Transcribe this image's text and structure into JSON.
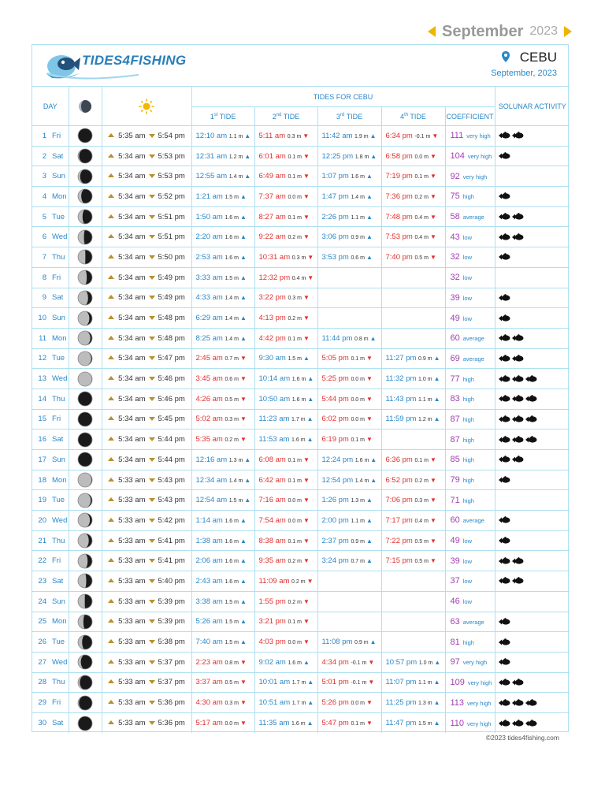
{
  "nav": {
    "month": "September",
    "year": "2023"
  },
  "header": {
    "logo_text": "TIDES4FISHING",
    "location": "CEBU",
    "date": "September, 2023"
  },
  "columns": {
    "day": "DAY",
    "tides_group": "TIDES FOR CEBU",
    "tide1": "TIDE",
    "tide1_ord": "st",
    "tide1_n": "1",
    "tide2": "TIDE",
    "tide2_ord": "nd",
    "tide2_n": "2",
    "tide3": "TIDE",
    "tide3_ord": "rd",
    "tide3_n": "3",
    "tide4": "TIDE",
    "tide4_ord": "th",
    "tide4_n": "4",
    "coefficient": "COEFFICIENT",
    "solunar": "SOLUNAR ACTIVITY"
  },
  "colors": {
    "high_tide": "#2a88c8",
    "low_tide": "#e03030",
    "coefficient": "#a040b0",
    "border": "#aee0f2"
  },
  "days": [
    {
      "n": "1",
      "wd": "Fri",
      "moon": 0.97,
      "rise": "5:35 am",
      "set": "5:54 pm",
      "tides": [
        [
          "12:10 am",
          "1.1 m",
          "H"
        ],
        [
          "5:11 am",
          "0.3 m",
          "L"
        ],
        [
          "11:42 am",
          "1.9 m",
          "H"
        ],
        [
          "6:34 pm",
          "-0.1 m",
          "L"
        ]
      ],
      "coef": "111",
      "lvl": "very high",
      "sol": 2
    },
    {
      "n": "2",
      "wd": "Sat",
      "moon": 0.92,
      "rise": "5:34 am",
      "set": "5:53 pm",
      "tides": [
        [
          "12:31 am",
          "1.2 m",
          "H"
        ],
        [
          "6:01 am",
          "0.1 m",
          "L"
        ],
        [
          "12:25 pm",
          "1.8 m",
          "H"
        ],
        [
          "6:58 pm",
          "0.0 m",
          "L"
        ]
      ],
      "coef": "104",
      "lvl": "very high",
      "sol": 1
    },
    {
      "n": "3",
      "wd": "Sun",
      "moon": 0.85,
      "rise": "5:34 am",
      "set": "5:53 pm",
      "tides": [
        [
          "12:55 am",
          "1.4 m",
          "H"
        ],
        [
          "6:49 am",
          "0.1 m",
          "L"
        ],
        [
          "1:07 pm",
          "1.6 m",
          "H"
        ],
        [
          "7:19 pm",
          "0.1 m",
          "L"
        ]
      ],
      "coef": "92",
      "lvl": "very high",
      "sol": 0
    },
    {
      "n": "4",
      "wd": "Mon",
      "moon": 0.77,
      "rise": "5:34 am",
      "set": "5:52 pm",
      "tides": [
        [
          "1:21 am",
          "1.5 m",
          "H"
        ],
        [
          "7:37 am",
          "0.0 m",
          "L"
        ],
        [
          "1:47 pm",
          "1.4 m",
          "H"
        ],
        [
          "7:36 pm",
          "0.2 m",
          "L"
        ]
      ],
      "coef": "75",
      "lvl": "high",
      "sol": 1
    },
    {
      "n": "5",
      "wd": "Tue",
      "moon": 0.68,
      "rise": "5:34 am",
      "set": "5:51 pm",
      "tides": [
        [
          "1:50 am",
          "1.6 m",
          "H"
        ],
        [
          "8:27 am",
          "0.1 m",
          "L"
        ],
        [
          "2:26 pm",
          "1.1 m",
          "H"
        ],
        [
          "7:48 pm",
          "0.4 m",
          "L"
        ]
      ],
      "coef": "58",
      "lvl": "average",
      "sol": 2
    },
    {
      "n": "6",
      "wd": "Wed",
      "moon": 0.58,
      "rise": "5:34 am",
      "set": "5:51 pm",
      "tides": [
        [
          "2:20 am",
          "1.6 m",
          "H"
        ],
        [
          "9:22 am",
          "0.2 m",
          "L"
        ],
        [
          "3:06 pm",
          "0.9 m",
          "H"
        ],
        [
          "7:53 pm",
          "0.4 m",
          "L"
        ]
      ],
      "coef": "43",
      "lvl": "low",
      "sol": 2
    },
    {
      "n": "7",
      "wd": "Thu",
      "moon": 0.48,
      "rise": "5:34 am",
      "set": "5:50 pm",
      "tides": [
        [
          "2:53 am",
          "1.6 m",
          "H"
        ],
        [
          "10:31 am",
          "0.3 m",
          "L"
        ],
        [
          "3:53 pm",
          "0.6 m",
          "H"
        ],
        [
          "7:40 pm",
          "0.5 m",
          "L"
        ]
      ],
      "coef": "32",
      "lvl": "low",
      "sol": 1
    },
    {
      "n": "8",
      "wd": "Fri",
      "moon": 0.38,
      "rise": "5:34 am",
      "set": "5:49 pm",
      "tides": [
        [
          "3:33 am",
          "1.5 m",
          "H"
        ],
        [
          "12:32 pm",
          "0.4 m",
          "L"
        ]
      ],
      "coef": "32",
      "lvl": "low",
      "sol": 0
    },
    {
      "n": "9",
      "wd": "Sat",
      "moon": 0.29,
      "rise": "5:34 am",
      "set": "5:49 pm",
      "tides": [
        [
          "4:33 am",
          "1.4 m",
          "H"
        ],
        [
          "3:22 pm",
          "0.3 m",
          "L"
        ]
      ],
      "coef": "39",
      "lvl": "low",
      "sol": 1
    },
    {
      "n": "10",
      "wd": "Sun",
      "moon": 0.2,
      "rise": "5:34 am",
      "set": "5:48 pm",
      "tides": [
        [
          "6:29 am",
          "1.4 m",
          "H"
        ],
        [
          "4:13 pm",
          "0.2 m",
          "L"
        ]
      ],
      "coef": "49",
      "lvl": "low",
      "sol": 1
    },
    {
      "n": "11",
      "wd": "Mon",
      "moon": 0.13,
      "rise": "5:34 am",
      "set": "5:48 pm",
      "tides": [
        [
          "8:25 am",
          "1.4 m",
          "H"
        ],
        [
          "4:42 pm",
          "0.1 m",
          "L"
        ],
        [
          "11:44 pm",
          "0.8 m",
          "H"
        ]
      ],
      "coef": "60",
      "lvl": "average",
      "sol": 2
    },
    {
      "n": "12",
      "wd": "Tue",
      "moon": 0.07,
      "rise": "5:34 am",
      "set": "5:47 pm",
      "tides": [
        [
          "2:45 am",
          "0.7 m",
          "L"
        ],
        [
          "9:30 am",
          "1.5 m",
          "H"
        ],
        [
          "5:05 pm",
          "0.1 m",
          "L"
        ],
        [
          "11:27 pm",
          "0.9 m",
          "H"
        ]
      ],
      "coef": "69",
      "lvl": "average",
      "sol": 2
    },
    {
      "n": "13",
      "wd": "Wed",
      "moon": 0.03,
      "rise": "5:34 am",
      "set": "5:46 pm",
      "tides": [
        [
          "3:45 am",
          "0.6 m",
          "L"
        ],
        [
          "10:14 am",
          "1.6 m",
          "H"
        ],
        [
          "5:25 pm",
          "0.0 m",
          "L"
        ],
        [
          "11:32 pm",
          "1.0 m",
          "H"
        ]
      ],
      "coef": "77",
      "lvl": "high",
      "sol": 3
    },
    {
      "n": "14",
      "wd": "Thu",
      "moon": 0.01,
      "rise": "5:34 am",
      "set": "5:46 pm",
      "tides": [
        [
          "4:26 am",
          "0.5 m",
          "L"
        ],
        [
          "10:50 am",
          "1.6 m",
          "H"
        ],
        [
          "5:44 pm",
          "0.0 m",
          "L"
        ],
        [
          "11:43 pm",
          "1.1 m",
          "H"
        ]
      ],
      "coef": "83",
      "lvl": "high",
      "sol": 3
    },
    {
      "n": "15",
      "wd": "Fri",
      "moon": 0.0,
      "rise": "5:34 am",
      "set": "5:45 pm",
      "tides": [
        [
          "5:02 am",
          "0.3 m",
          "L"
        ],
        [
          "11:23 am",
          "1.7 m",
          "H"
        ],
        [
          "6:02 pm",
          "0.0 m",
          "L"
        ],
        [
          "11:59 pm",
          "1.2 m",
          "H"
        ]
      ],
      "coef": "87",
      "lvl": "high",
      "sol": 3
    },
    {
      "n": "16",
      "wd": "Sat",
      "moon": 0.0,
      "rise": "5:34 am",
      "set": "5:44 pm",
      "tides": [
        [
          "5:35 am",
          "0.2 m",
          "L"
        ],
        [
          "11:53 am",
          "1.6 m",
          "H"
        ],
        [
          "6:19 pm",
          "0.1 m",
          "L"
        ]
      ],
      "coef": "87",
      "lvl": "high",
      "sol": 3
    },
    {
      "n": "17",
      "wd": "Sun",
      "moon": 0.02,
      "rise": "5:34 am",
      "set": "5:44 pm",
      "tides": [
        [
          "12:16 am",
          "1.3 m",
          "H"
        ],
        [
          "6:08 am",
          "0.1 m",
          "L"
        ],
        [
          "12:24 pm",
          "1.6 m",
          "H"
        ],
        [
          "6:36 pm",
          "0.1 m",
          "L"
        ]
      ],
      "coef": "85",
      "lvl": "high",
      "sol": 2
    },
    {
      "n": "18",
      "wd": "Mon",
      "moon": 0.05,
      "rise": "5:33 am",
      "set": "5:43 pm",
      "tides": [
        [
          "12:34 am",
          "1.4 m",
          "H"
        ],
        [
          "6:42 am",
          "0.1 m",
          "L"
        ],
        [
          "12:54 pm",
          "1.4 m",
          "H"
        ],
        [
          "6:52 pm",
          "0.2 m",
          "L"
        ]
      ],
      "coef": "79",
      "lvl": "high",
      "sol": 1
    },
    {
      "n": "19",
      "wd": "Tue",
      "moon": 0.1,
      "rise": "5:33 am",
      "set": "5:43 pm",
      "tides": [
        [
          "12:54 am",
          "1.5 m",
          "H"
        ],
        [
          "7:16 am",
          "0.0 m",
          "L"
        ],
        [
          "1:26 pm",
          "1.3 m",
          "H"
        ],
        [
          "7:06 pm",
          "0.3 m",
          "L"
        ]
      ],
      "coef": "71",
      "lvl": "high",
      "sol": 0
    },
    {
      "n": "20",
      "wd": "Wed",
      "moon": 0.16,
      "rise": "5:33 am",
      "set": "5:42 pm",
      "tides": [
        [
          "1:14 am",
          "1.6 m",
          "H"
        ],
        [
          "7:54 am",
          "0.0 m",
          "L"
        ],
        [
          "2:00 pm",
          "1.1 m",
          "H"
        ],
        [
          "7:17 pm",
          "0.4 m",
          "L"
        ]
      ],
      "coef": "60",
      "lvl": "average",
      "sol": 1
    },
    {
      "n": "21",
      "wd": "Thu",
      "moon": 0.24,
      "rise": "5:33 am",
      "set": "5:41 pm",
      "tides": [
        [
          "1:38 am",
          "1.6 m",
          "H"
        ],
        [
          "8:38 am",
          "0.1 m",
          "L"
        ],
        [
          "2:37 pm",
          "0.9 m",
          "H"
        ],
        [
          "7:22 pm",
          "0.5 m",
          "L"
        ]
      ],
      "coef": "49",
      "lvl": "low",
      "sol": 1
    },
    {
      "n": "22",
      "wd": "Fri",
      "moon": 0.32,
      "rise": "5:33 am",
      "set": "5:41 pm",
      "tides": [
        [
          "2:06 am",
          "1.6 m",
          "H"
        ],
        [
          "9:35 am",
          "0.2 m",
          "L"
        ],
        [
          "3:24 pm",
          "0.7 m",
          "H"
        ],
        [
          "7:15 pm",
          "0.5 m",
          "L"
        ]
      ],
      "coef": "39",
      "lvl": "low",
      "sol": 2
    },
    {
      "n": "23",
      "wd": "Sat",
      "moon": 0.42,
      "rise": "5:33 am",
      "set": "5:40 pm",
      "tides": [
        [
          "2:43 am",
          "1.6 m",
          "H"
        ],
        [
          "11:09 am",
          "0.2 m",
          "L"
        ]
      ],
      "coef": "37",
      "lvl": "low",
      "sol": 2
    },
    {
      "n": "24",
      "wd": "Sun",
      "moon": 0.52,
      "rise": "5:33 am",
      "set": "5:39 pm",
      "tides": [
        [
          "3:38 am",
          "1.5 m",
          "H"
        ],
        [
          "1:55 pm",
          "0.2 m",
          "L"
        ]
      ],
      "coef": "46",
      "lvl": "low",
      "sol": 0
    },
    {
      "n": "25",
      "wd": "Mon",
      "moon": 0.62,
      "rise": "5:33 am",
      "set": "5:39 pm",
      "tides": [
        [
          "5:26 am",
          "1.5 m",
          "H"
        ],
        [
          "3:21 pm",
          "0.1 m",
          "L"
        ]
      ],
      "coef": "63",
      "lvl": "average",
      "sol": 1
    },
    {
      "n": "26",
      "wd": "Tue",
      "moon": 0.71,
      "rise": "5:33 am",
      "set": "5:38 pm",
      "tides": [
        [
          "7:40 am",
          "1.5 m",
          "H"
        ],
        [
          "4:03 pm",
          "0.0 m",
          "L"
        ],
        [
          "11:08 pm",
          "0.9 m",
          "H"
        ]
      ],
      "coef": "81",
      "lvl": "high",
      "sol": 1
    },
    {
      "n": "27",
      "wd": "Wed",
      "moon": 0.8,
      "rise": "5:33 am",
      "set": "5:37 pm",
      "tides": [
        [
          "2:23 am",
          "0.8 m",
          "L"
        ],
        [
          "9:02 am",
          "1.6 m",
          "H"
        ],
        [
          "4:34 pm",
          "-0.1 m",
          "L"
        ],
        [
          "10:57 pm",
          "1.0 m",
          "H"
        ]
      ],
      "coef": "97",
      "lvl": "very high",
      "sol": 1
    },
    {
      "n": "28",
      "wd": "Thu",
      "moon": 0.87,
      "rise": "5:33 am",
      "set": "5:37 pm",
      "tides": [
        [
          "3:37 am",
          "0.5 m",
          "L"
        ],
        [
          "10:01 am",
          "1.7 m",
          "H"
        ],
        [
          "5:01 pm",
          "-0.1 m",
          "L"
        ],
        [
          "11:07 pm",
          "1.1 m",
          "H"
        ]
      ],
      "coef": "109",
      "lvl": "very high",
      "sol": 2
    },
    {
      "n": "29",
      "wd": "Fri",
      "moon": 0.93,
      "rise": "5:33 am",
      "set": "5:36 pm",
      "tides": [
        [
          "4:30 am",
          "0.3 m",
          "L"
        ],
        [
          "10:51 am",
          "1.7 m",
          "H"
        ],
        [
          "5:26 pm",
          "0.0 m",
          "L"
        ],
        [
          "11:25 pm",
          "1.3 m",
          "H"
        ]
      ],
      "coef": "113",
      "lvl": "very high",
      "sol": 3
    },
    {
      "n": "30",
      "wd": "Sat",
      "moon": 0.97,
      "rise": "5:33 am",
      "set": "5:36 pm",
      "tides": [
        [
          "5:17 am",
          "0.0 m",
          "L"
        ],
        [
          "11:35 am",
          "1.6 m",
          "H"
        ],
        [
          "5:47 pm",
          "0.1 m",
          "L"
        ],
        [
          "11:47 pm",
          "1.5 m",
          "H"
        ]
      ],
      "coef": "110",
      "lvl": "very high",
      "sol": 3
    }
  ],
  "footer": {
    "copyright": "©2023  tides4fishing.com"
  }
}
